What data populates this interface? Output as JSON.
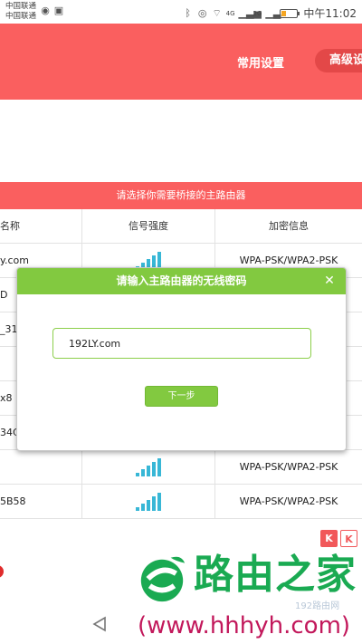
{
  "status_bar": {
    "carrier_1": "中国联通",
    "carrier_2": "中国联通",
    "icons_left": [
      "weibo-icon",
      "shopping-icon"
    ],
    "icons_right": [
      "bluetooth-icon",
      "eye-icon",
      "wifi-icon",
      "signal-4g-icon",
      "signal-2g-icon",
      "battery-icon"
    ],
    "network_1": "4G",
    "network_2": "2G",
    "time": "中午11:02"
  },
  "header": {
    "menu_common": "常用设置",
    "menu_advanced": "高级设"
  },
  "router_table": {
    "title": "请选择你需要桥接的主路由器",
    "columns": [
      "名称",
      "信号强度",
      "加密信息"
    ],
    "rows": [
      {
        "name": "y.com",
        "signal_bars": 5,
        "encryption": "WPA-PSK/WPA2-PSK"
      },
      {
        "name": "D",
        "signal_bars": 0,
        "encryption": ""
      },
      {
        "name": "_31",
        "signal_bars": 0,
        "encryption": ""
      },
      {
        "name": "",
        "signal_bars": 0,
        "encryption": ""
      },
      {
        "name": "x8",
        "signal_bars": 0,
        "encryption": ""
      },
      {
        "name": "34C",
        "signal_bars": 0,
        "encryption": ""
      },
      {
        "name": "",
        "signal_bars": 5,
        "encryption": "WPA-PSK/WPA2-PSK"
      },
      {
        "name": "5B58",
        "signal_bars": 5,
        "encryption": "WPA-PSK/WPA2-PSK"
      }
    ]
  },
  "modal": {
    "title": "请输入主路由器的无线密码",
    "close_icon": "close-icon",
    "password_value": "192LY.com",
    "next_label": "下一步"
  },
  "watermark": {
    "ad_k1": "K",
    "ad_k2": "K",
    "logo_text": "路由之家",
    "small_text": "192路由网",
    "url": "(www.hhhyh.com)"
  },
  "colors": {
    "header_red": "#fa5f5f",
    "modal_green": "#82c940",
    "signal_blue": "#38b7d6",
    "logo_green": "#1aaa52",
    "url_magenta": "#c2185b"
  }
}
